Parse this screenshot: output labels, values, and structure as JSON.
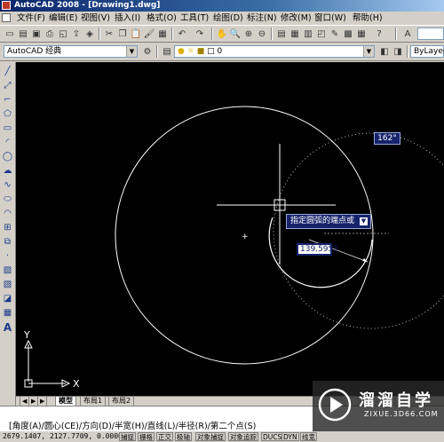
{
  "window": {
    "title": "AutoCAD 2008 - [Drawing1.dwg]"
  },
  "menu": [
    "文件(F)",
    "编辑(E)",
    "视图(V)",
    "插入(I)",
    "格式(O)",
    "工具(T)",
    "绘图(D)",
    "标注(N)",
    "修改(M)",
    "窗口(W)",
    "帮助(H)"
  ],
  "toolbar": {
    "workspace": "AutoCAD 经典",
    "layer": "0",
    "linetype": "ByLayer"
  },
  "tabs": [
    "模型",
    "布局1",
    "布局2"
  ],
  "canvas": {
    "angle_tip": "162°",
    "prompt_tip": "指定圆弧的端点或",
    "radius_input": "139.5951",
    "ucs_x": "X",
    "ucs_y": "Y"
  },
  "command_line": "[角度(A)/圆心(CE)/方向(D)/半宽(H)/直线(L)/半径(R)/第二个点(S)",
  "status": {
    "coords": "2679.1407, 2127.7709, 0.0000",
    "toggles": [
      "捕捉",
      "栅格",
      "正交",
      "极轴",
      "对象捕捉",
      "对象追踪",
      "DUCS",
      "DYN",
      "线宽"
    ]
  },
  "watermark": {
    "name": "溜溜自学",
    "url": "ZIXUE.3D66.COM"
  }
}
